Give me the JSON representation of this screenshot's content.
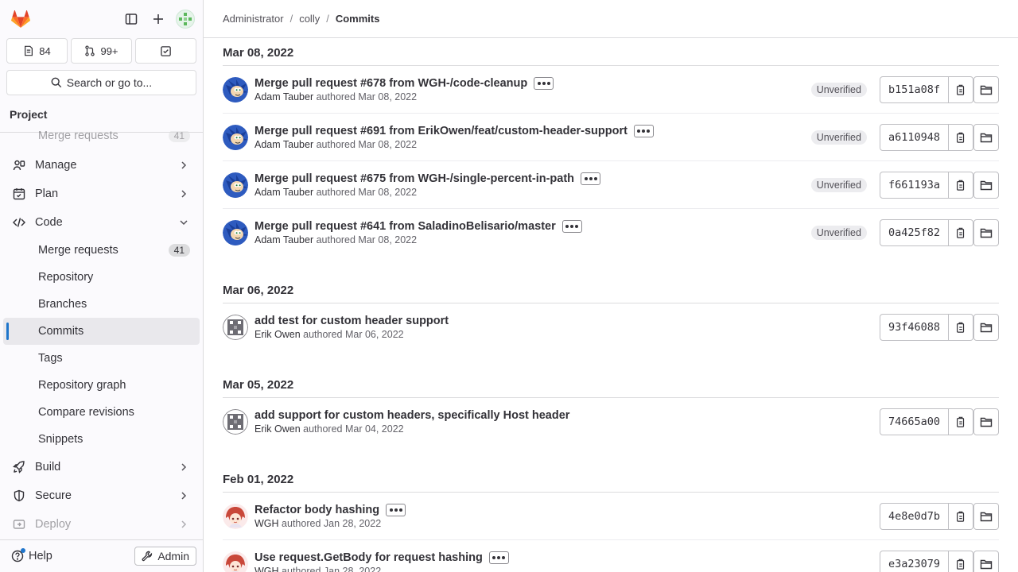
{
  "sidebar": {
    "counters": {
      "issues": "84",
      "merge_requests": "99+"
    },
    "search_label": "Search or go to...",
    "project_label": "Project",
    "nav": {
      "faded_item": {
        "label": "Merge requests",
        "count": "41"
      },
      "manage": "Manage",
      "plan": "Plan",
      "code": "Code",
      "code_items": [
        {
          "label": "Merge requests",
          "count": "41"
        },
        {
          "label": "Repository"
        },
        {
          "label": "Branches"
        },
        {
          "label": "Commits"
        },
        {
          "label": "Tags"
        },
        {
          "label": "Repository graph"
        },
        {
          "label": "Compare revisions"
        },
        {
          "label": "Snippets"
        }
      ],
      "build": "Build",
      "secure": "Secure",
      "deploy": "Deploy"
    },
    "help": "Help",
    "admin": "Admin"
  },
  "breadcrumb": {
    "items": [
      "Administrator",
      "colly",
      "Commits"
    ]
  },
  "commit_days": [
    {
      "date": "Mar 08, 2022",
      "commits": [
        {
          "title": "Merge pull request #678 from WGH-/code-cleanup",
          "author": "Adam Tauber",
          "authored": "authored Mar 08, 2022",
          "badge": "Unverified",
          "sha": "b151a08f"
        },
        {
          "title": "Merge pull request #691 from ErikOwen/feat/custom-header-support",
          "author": "Adam Tauber",
          "authored": "authored Mar 08, 2022",
          "badge": "Unverified",
          "sha": "a6110948"
        },
        {
          "title": "Merge pull request #675 from WGH-/single-percent-in-path",
          "author": "Adam Tauber",
          "authored": "authored Mar 08, 2022",
          "badge": "Unverified",
          "sha": "f661193a"
        },
        {
          "title": "Merge pull request #641 from SaladinoBelisario/master",
          "author": "Adam Tauber",
          "authored": "authored Mar 08, 2022",
          "badge": "Unverified",
          "sha": "0a425f82"
        }
      ]
    },
    {
      "date": "Mar 06, 2022",
      "commits": [
        {
          "title": "add test for custom header support",
          "author": "Erik Owen",
          "authored": "authored Mar 06, 2022",
          "sha": "93f46088"
        }
      ]
    },
    {
      "date": "Mar 05, 2022",
      "commits": [
        {
          "title": "add support for custom headers, specifically Host header",
          "author": "Erik Owen",
          "authored": "authored Mar 04, 2022",
          "sha": "74665a00"
        }
      ]
    },
    {
      "date": "Feb 01, 2022",
      "commits": [
        {
          "title": "Refactor body hashing",
          "author": "WGH",
          "authored": "authored Jan 28, 2022",
          "sha": "4e8e0d7b"
        },
        {
          "title": "Use request.GetBody for request hashing",
          "author": "WGH",
          "authored": "authored Jan 28, 2022",
          "sha": "e3a23079"
        }
      ]
    }
  ],
  "colors": {
    "accent": "#1f75cb",
    "brand_orange": "#e24329"
  }
}
